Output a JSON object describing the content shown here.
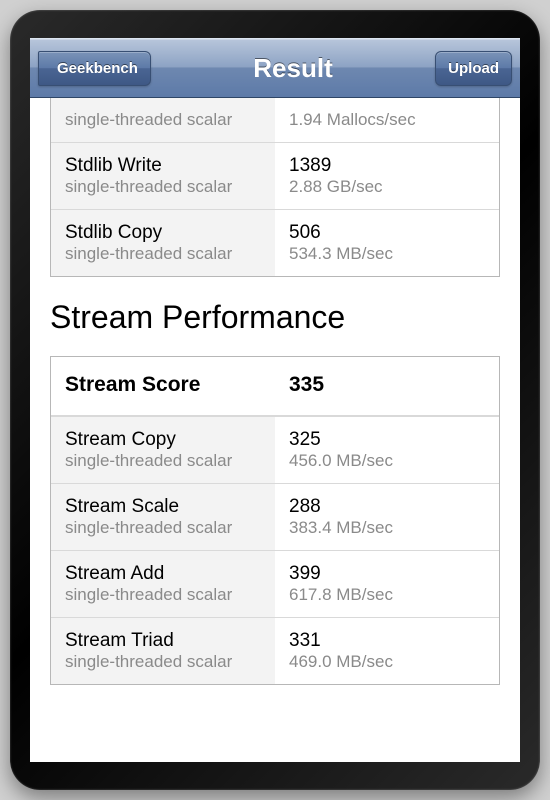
{
  "navbar": {
    "back_label": "Geekbench",
    "title": "Result",
    "upload_label": "Upload"
  },
  "top_table": {
    "rows": [
      {
        "name_sub": "single-threaded scalar",
        "value_sub": "1.94 Mallocs/sec",
        "score": "",
        "name": ""
      },
      {
        "name": "Stdlib Write",
        "name_sub": "single-threaded scalar",
        "score": "1389",
        "value_sub": "2.88 GB/sec"
      },
      {
        "name": "Stdlib Copy",
        "name_sub": "single-threaded scalar",
        "score": "506",
        "value_sub": "534.3 MB/sec"
      }
    ]
  },
  "section": {
    "heading": "Stream Performance",
    "score_label": "Stream Score",
    "score_value": "335",
    "rows": [
      {
        "name": "Stream Copy",
        "name_sub": "single-threaded scalar",
        "score": "325",
        "value_sub": "456.0 MB/sec"
      },
      {
        "name": "Stream Scale",
        "name_sub": "single-threaded scalar",
        "score": "288",
        "value_sub": "383.4 MB/sec"
      },
      {
        "name": "Stream Add",
        "name_sub": "single-threaded scalar",
        "score": "399",
        "value_sub": "617.8 MB/sec"
      },
      {
        "name": "Stream Triad",
        "name_sub": "single-threaded scalar",
        "score": "331",
        "value_sub": "469.0 MB/sec"
      }
    ]
  }
}
